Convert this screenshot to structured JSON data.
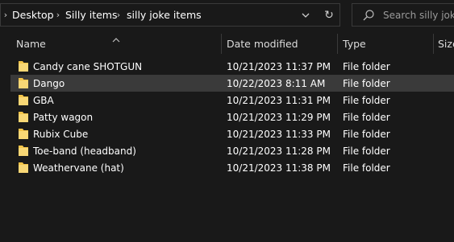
{
  "address_bar": {
    "crumbs": [
      "Desktop",
      "Silly items",
      "silly joke items"
    ]
  },
  "search": {
    "placeholder": "Search silly joke items"
  },
  "columns": {
    "name": "Name",
    "date": "Date modified",
    "type": "Type",
    "size": "Size"
  },
  "files": [
    {
      "name": "Candy cane SHOTGUN",
      "date": "10/21/2023 11:37 PM",
      "type": "File folder"
    },
    {
      "name": "Dango",
      "date": "10/22/2023 8:11 AM",
      "type": "File folder",
      "selected": true
    },
    {
      "name": "GBA",
      "date": "10/21/2023 11:31 PM",
      "type": "File folder"
    },
    {
      "name": "Patty wagon",
      "date": "10/21/2023 11:29 PM",
      "type": "File folder"
    },
    {
      "name": "Rubix Cube",
      "date": "10/21/2023 11:33 PM",
      "type": "File folder"
    },
    {
      "name": "Toe-band (headband)",
      "date": "10/21/2023 11:28 PM",
      "type": "File folder"
    },
    {
      "name": "Weathervane (hat)",
      "date": "10/21/2023 11:38 PM",
      "type": "File folder"
    }
  ],
  "colors": {
    "background": "#191919",
    "selected_row": "#3a3a3a",
    "folder": "#f3c448"
  },
  "icons": [
    "chevron-right-icon",
    "chevron-down-icon",
    "refresh-icon",
    "search-icon",
    "sort-up-icon",
    "folder-icon"
  ]
}
